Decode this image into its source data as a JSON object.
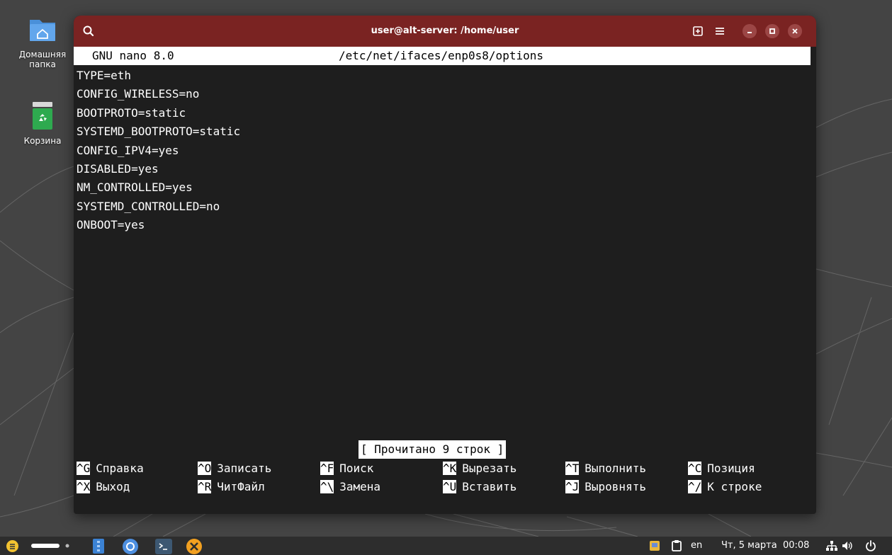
{
  "desktop": {
    "icons": [
      {
        "label": "Домашняя папка",
        "icon": "home-folder-icon"
      },
      {
        "label": "Корзина",
        "icon": "trash-icon"
      }
    ]
  },
  "window": {
    "title": "user@alt-server: /home/user",
    "titlebar_color": "#7a2322",
    "buttons": [
      "search-icon",
      "new-tab-icon",
      "menu-icon",
      "minimize-icon",
      "maximize-icon",
      "close-icon"
    ]
  },
  "nano": {
    "version": "GNU nano 8.0",
    "filename": "/etc/net/ifaces/enp0s8/options",
    "lines": [
      "TYPE=eth",
      "CONFIG_WIRELESS=no",
      "BOOTPROTO=static",
      "SYSTEMD_BOOTPROTO=static",
      "CONFIG_IPV4=yes",
      "DISABLED=yes",
      "NM_CONTROLLED=yes",
      "SYSTEMD_CONTROLLED=no",
      "ONBOOT=yes"
    ],
    "status": "[ Прочитано 9 строк ]",
    "shortcuts_row1": [
      {
        "key": "^G",
        "label": "Справка"
      },
      {
        "key": "^O",
        "label": "Записать"
      },
      {
        "key": "^F",
        "label": "Поиск"
      },
      {
        "key": "^K",
        "label": "Вырезать"
      },
      {
        "key": "^T",
        "label": "Выполнить"
      },
      {
        "key": "^C",
        "label": "Позиция"
      }
    ],
    "shortcuts_row2": [
      {
        "key": "^X",
        "label": "Выход"
      },
      {
        "key": "^R",
        "label": "ЧитФайл"
      },
      {
        "key": "^\\",
        "label": "Замена"
      },
      {
        "key": "^U",
        "label": "Вставить"
      },
      {
        "key": "^J",
        "label": "Выровнять"
      },
      {
        "key": "^/",
        "label": "К строке"
      }
    ]
  },
  "taskbar": {
    "apps": [
      "start-menu-icon",
      "workspace-indicator-icon",
      "file-manager-icon",
      "chromium-icon",
      "terminal-icon",
      "settings-icon"
    ],
    "tray": {
      "language": "en",
      "datetime": "Чт, 5 марта  00:08",
      "icons": [
        "notes-icon",
        "clipboard-icon",
        "network-icon",
        "volume-icon",
        "power-icon"
      ]
    }
  }
}
